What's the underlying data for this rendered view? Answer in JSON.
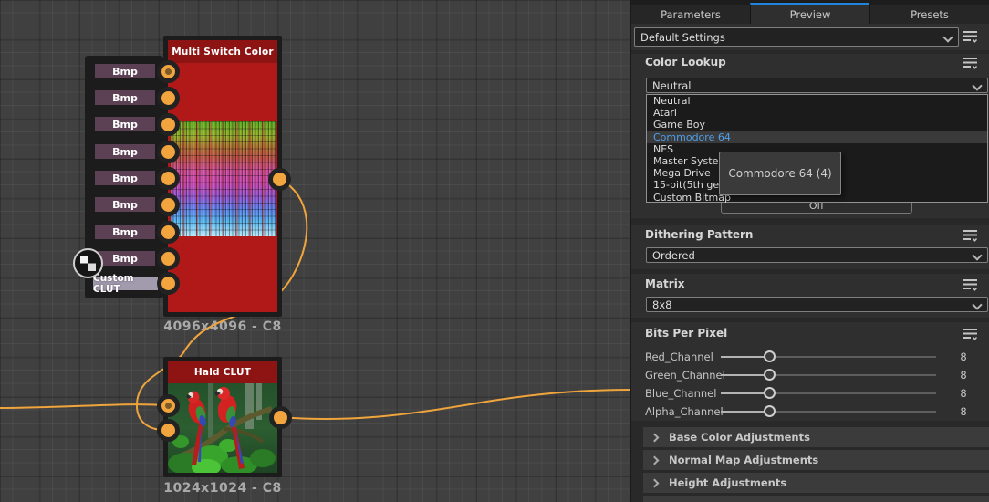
{
  "canvas": {
    "multi_switch_node": {
      "title": "Multi Switch Color",
      "inputs": [
        "Bmp",
        "Bmp",
        "Bmp",
        "Bmp",
        "Bmp",
        "Bmp",
        "Bmp",
        "Bmp"
      ],
      "clut_input": "Custom CLUT",
      "size_label": "4096x4096 - C8"
    },
    "hald_node": {
      "title": "Hald CLUT",
      "size_label": "1024x1024 - C8"
    },
    "wire_color": "#f0a43c"
  },
  "panel": {
    "tabs": [
      {
        "label": "Parameters",
        "active": false
      },
      {
        "label": "Preview",
        "active": true
      },
      {
        "label": "Presets",
        "active": false
      }
    ],
    "preset_selector": {
      "value": "Default Settings"
    },
    "color_lookup": {
      "title": "Color Lookup",
      "value": "Neutral",
      "options": [
        "Neutral",
        "Atari",
        "Game Boy",
        "Commodore 64",
        "NES",
        "Master System",
        "Mega Drive",
        "15-bit(5th gen)",
        "Custom Bitmap"
      ],
      "highlighted_index": 3,
      "tooltip": "Commodore 64 (4)",
      "off_button": "Off"
    },
    "dithering_pattern": {
      "title": "Dithering Pattern",
      "value": "Ordered"
    },
    "matrix": {
      "title": "Matrix",
      "value": "8x8"
    },
    "bits_per_pixel": {
      "title": "Bits Per Pixel",
      "sliders": [
        {
          "label": "Red_Channel",
          "value": "8"
        },
        {
          "label": "Green_Channel",
          "value": "8"
        },
        {
          "label": "Blue_Channel",
          "value": "8"
        },
        {
          "label": "Alpha_Channel",
          "value": "8"
        }
      ]
    },
    "collapsed_sections": [
      {
        "label": "Base Color Adjustments"
      },
      {
        "label": "Normal Map Adjustments"
      },
      {
        "label": "Height Adjustments"
      }
    ],
    "colors": {
      "accent_blue": "#1f86dc",
      "option_highlight": "#4f9ee8",
      "wire_orange": "#f0a43c"
    }
  }
}
